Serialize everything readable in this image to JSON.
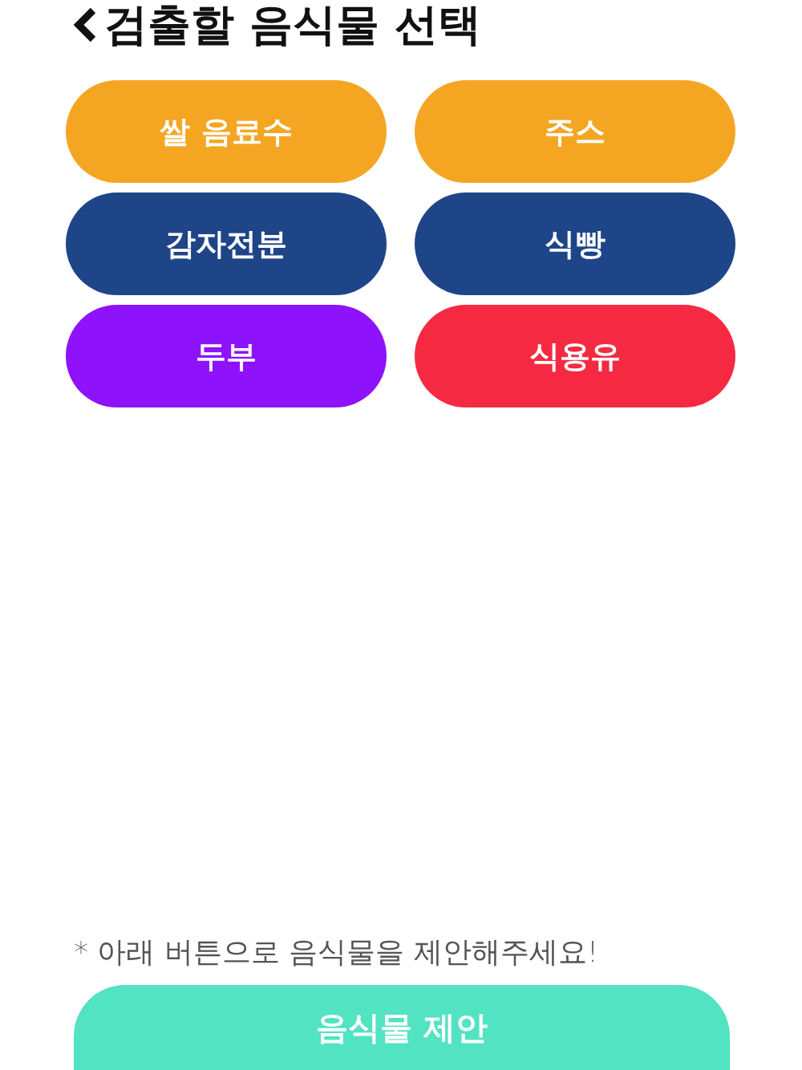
{
  "header": {
    "title": "검출할 음식물 선택"
  },
  "foods": [
    {
      "label": "쌀 음료수",
      "color": "#f4a623"
    },
    {
      "label": "주스",
      "color": "#f4a623"
    },
    {
      "label": "감자전분",
      "color": "#1f4589"
    },
    {
      "label": "식빵",
      "color": "#1f4589"
    },
    {
      "label": "두부",
      "color": "#8e12fb"
    },
    {
      "label": "식용유",
      "color": "#f52a42"
    }
  ],
  "note": "* 아래 버튼으로 음식물을 제안해주세요!",
  "suggest_button": {
    "label": "음식물 제안"
  }
}
